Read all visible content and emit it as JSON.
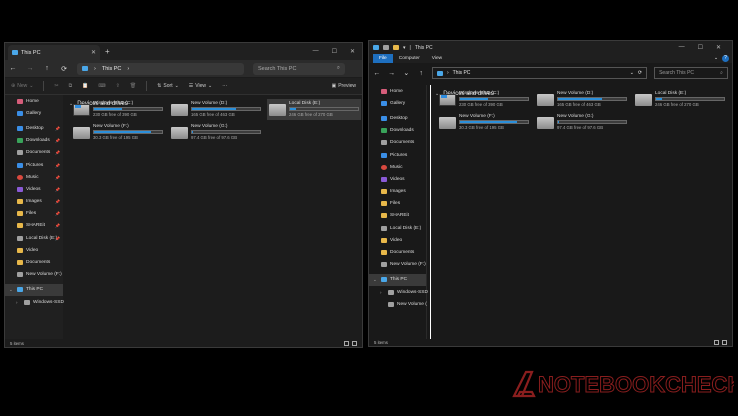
{
  "left_window": {
    "tab_title": "This PC",
    "address": "This PC",
    "search_placeholder": "Search This PC",
    "toolbar": {
      "new": "New",
      "sort": "Sort",
      "view": "View",
      "more": "···",
      "preview": "Preview"
    },
    "sidebar": [
      {
        "label": "Home",
        "icon": "home-icon"
      },
      {
        "label": "Gallery",
        "icon": "gallery-icon"
      },
      {
        "label": "Desktop",
        "icon": "desktop-icon",
        "pinned": true
      },
      {
        "label": "Downloads",
        "icon": "downloads-icon",
        "pinned": true
      },
      {
        "label": "Documents",
        "icon": "documents-icon",
        "pinned": true
      },
      {
        "label": "Pictures",
        "icon": "pictures-icon",
        "pinned": true
      },
      {
        "label": "Music",
        "icon": "music-icon",
        "pinned": true
      },
      {
        "label": "Videos",
        "icon": "videos-icon",
        "pinned": true
      },
      {
        "label": "Images",
        "icon": "folder-icon",
        "pinned": true
      },
      {
        "label": "Files",
        "icon": "folder-icon",
        "pinned": true
      },
      {
        "label": "SHAREit",
        "icon": "folder-icon",
        "pinned": true
      },
      {
        "label": "Local Disk (E:)",
        "icon": "drive-icon",
        "pinned": true
      },
      {
        "label": "Video",
        "icon": "folder-icon"
      },
      {
        "label": "Documents",
        "icon": "folder-icon"
      },
      {
        "label": "New Volume (F:)",
        "icon": "drive-icon"
      },
      {
        "label": "This PC",
        "icon": "this-pc-icon",
        "selected": true
      },
      {
        "label": "Windows-SSD",
        "icon": "drive-icon"
      }
    ],
    "section_title": "Devices and drives",
    "drives": [
      {
        "name": "Windows-SSD (C:)",
        "free": "230 GB free of 390 GB",
        "used_fraction": 0.41
      },
      {
        "name": "New Volume (D:)",
        "free": "165 GB free of 463 GB",
        "used_fraction": 0.64
      },
      {
        "name": "Local Disk (E:)",
        "free": "246 GB free of 270 GB",
        "used_fraction": 0.09
      },
      {
        "name": "New Volume (F:)",
        "free": "30.3 GB free of 195 GB",
        "used_fraction": 0.84
      },
      {
        "name": "New Volume (G:)",
        "free": "97.4 GB free of 97.6 GB",
        "used_fraction": 0.01
      }
    ],
    "status": "5 items"
  },
  "right_window": {
    "title": "This PC",
    "ribbon_tabs": [
      "File",
      "Computer",
      "View"
    ],
    "address": "This PC",
    "search_placeholder": "Search This PC",
    "sidebar": [
      {
        "label": "Home",
        "icon": "home-icon"
      },
      {
        "label": "Gallery",
        "icon": "gallery-icon"
      },
      {
        "label": "Desktop",
        "icon": "desktop-icon"
      },
      {
        "label": "Downloads",
        "icon": "downloads-icon"
      },
      {
        "label": "Documents",
        "icon": "documents-icon"
      },
      {
        "label": "Pictures",
        "icon": "pictures-icon"
      },
      {
        "label": "Music",
        "icon": "music-icon"
      },
      {
        "label": "Videos",
        "icon": "videos-icon"
      },
      {
        "label": "Images",
        "icon": "folder-icon"
      },
      {
        "label": "Files",
        "icon": "folder-icon"
      },
      {
        "label": "SHAREit",
        "icon": "folder-icon"
      },
      {
        "label": "Local Disk (E:)",
        "icon": "drive-icon"
      },
      {
        "label": "Video",
        "icon": "folder-icon"
      },
      {
        "label": "Documents",
        "icon": "folder-icon"
      },
      {
        "label": "New Volume (F:)",
        "icon": "drive-icon"
      },
      {
        "label": "This PC",
        "icon": "this-pc-icon",
        "selected": true
      },
      {
        "label": "Windows-SSD",
        "icon": "drive-icon"
      },
      {
        "label": "New Volume (",
        "icon": "drive-icon"
      }
    ],
    "section_title": "Devices and drives",
    "drives": [
      {
        "name": "Windows-SSD (C:)",
        "free": "230 GB free of 390 GB",
        "used_fraction": 0.41
      },
      {
        "name": "New Volume (D:)",
        "free": "165 GB free of 463 GB",
        "used_fraction": 0.64
      },
      {
        "name": "Local Disk (E:)",
        "free": "246 GB free of 270 GB",
        "used_fraction": 0.09
      },
      {
        "name": "New Volume (F:)",
        "free": "30.3 GB free of 195 GB",
        "used_fraction": 0.84
      },
      {
        "name": "New Volume (G:)",
        "free": "97.4 GB free of 97.6 GB",
        "used_fraction": 0.01
      }
    ],
    "status": "5 items"
  },
  "watermark": "NOTEBOOKCHECK",
  "colors": {
    "accent": "#2c8fd9",
    "watermark": "#8a1e1e"
  }
}
